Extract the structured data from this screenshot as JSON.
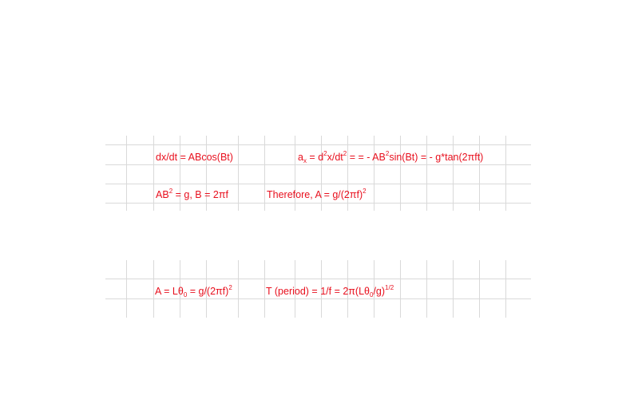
{
  "colors": {
    "text": "#e8101e",
    "grid": "#d9d9d9"
  },
  "block1": {
    "row1": {
      "dxdt": "dx/dt = ABcos(Bt)",
      "ax": {
        "a": "a",
        "x": "x",
        "eq": " = d",
        "two1": "2",
        "mid": "x/dt",
        "two2": "2",
        "rest1": " = = - AB",
        "two3": "2",
        "rest2": "sin(Bt) = - g*tan(2πft)"
      }
    },
    "row2": {
      "ab": {
        "a": "AB",
        "two": "2",
        "rest": " = g,  B = 2πf"
      },
      "therefore": {
        "text": "Therefore, A = g/(2πf)",
        "two": "2"
      }
    }
  },
  "block2": {
    "amp": {
      "a": "A = Lθ",
      "zero": "0",
      "b": " = g/(2πf)",
      "two": "2"
    },
    "period": {
      "a": "T (period) = 1/f = 2π(Lθ",
      "zero": "0",
      "b": "/g)",
      "half": "1/2"
    }
  }
}
